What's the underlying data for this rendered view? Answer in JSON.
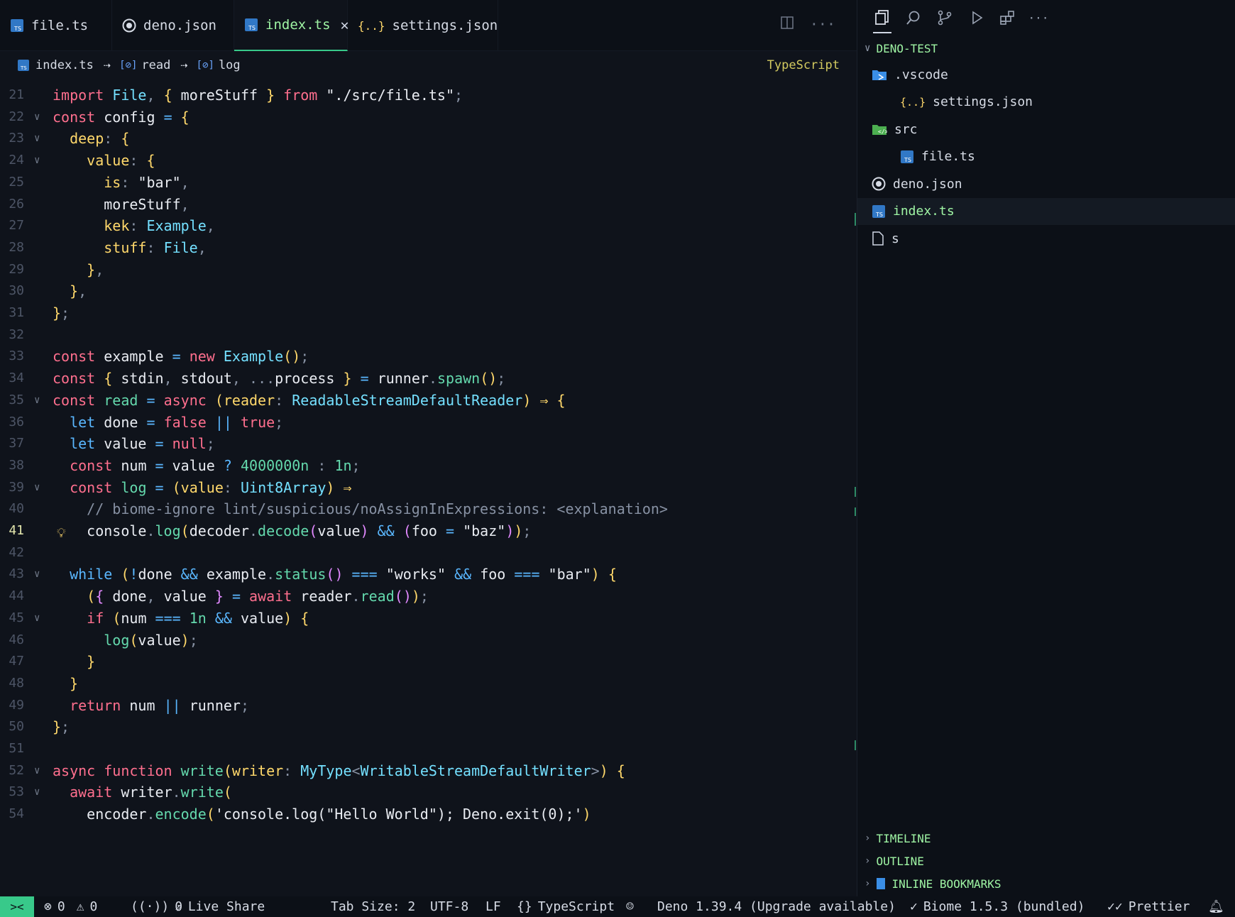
{
  "tabs": [
    {
      "label": "file.ts",
      "icon": "ts-file-icon"
    },
    {
      "label": "deno.json",
      "icon": "deno-icon"
    },
    {
      "label": "index.ts",
      "icon": "ts-file-icon",
      "active": true
    },
    {
      "label": "settings.json",
      "icon": "json-braces-icon"
    }
  ],
  "breadcrumb": {
    "file": "index.ts",
    "sym1": "read",
    "sym2": "log",
    "sep": "⇢",
    "language": "TypeScript"
  },
  "code": {
    "current_line": 41,
    "lines": [
      {
        "n": "21",
        "text": "import File, { moreStuff } from \"./src/file.ts\";"
      },
      {
        "n": "22",
        "text": "const config = {"
      },
      {
        "n": "23",
        "text": "  deep: {"
      },
      {
        "n": "24",
        "text": "    value: {"
      },
      {
        "n": "25",
        "text": "      is: \"bar\","
      },
      {
        "n": "26",
        "text": "      moreStuff,"
      },
      {
        "n": "27",
        "text": "      kek: Example,"
      },
      {
        "n": "28",
        "text": "      stuff: File,"
      },
      {
        "n": "29",
        "text": "    },"
      },
      {
        "n": "30",
        "text": "  },"
      },
      {
        "n": "31",
        "text": "};"
      },
      {
        "n": "32",
        "text": ""
      },
      {
        "n": "33",
        "text": "const example = new Example();"
      },
      {
        "n": "34",
        "text": "const { stdin, stdout, ...process } = runner.spawn();"
      },
      {
        "n": "35",
        "text": "const read = async (reader: ReadableStreamDefaultReader) ⇒ {"
      },
      {
        "n": "36",
        "text": "  let done = false || true;"
      },
      {
        "n": "37",
        "text": "  let value = null;"
      },
      {
        "n": "38",
        "text": "  const num = value ? 4000000n : 1n;"
      },
      {
        "n": "39",
        "text": "  const log = (value: Uint8Array) ⇒"
      },
      {
        "n": "40",
        "text": "    // biome-ignore lint/suspicious/noAssignInExpressions: <explanation>"
      },
      {
        "n": "41",
        "text": "    console.log(decoder.decode(value) && (foo = \"baz\"));"
      },
      {
        "n": "42",
        "text": ""
      },
      {
        "n": "43",
        "text": "  while (!done && example.status() === \"works\" && foo === \"bar\") {"
      },
      {
        "n": "44",
        "text": "    ({ done, value } = await reader.read());"
      },
      {
        "n": "45",
        "text": "    if (num === 1n && value) {"
      },
      {
        "n": "46",
        "text": "      log(value);"
      },
      {
        "n": "47",
        "text": "    }"
      },
      {
        "n": "48",
        "text": "  }"
      },
      {
        "n": "49",
        "text": "  return num || runner;"
      },
      {
        "n": "50",
        "text": "};"
      },
      {
        "n": "51",
        "text": ""
      },
      {
        "n": "52",
        "text": "async function write(writer: MyType<WritableStreamDefaultWriter>) {"
      },
      {
        "n": "53",
        "text": "  await writer.write("
      },
      {
        "n": "54",
        "text": "    encoder.encode('console.log(\"Hello World\"); Deno.exit(0);')"
      }
    ]
  },
  "explorer": {
    "title": "DENO-TEST",
    "items": [
      {
        "label": ".vscode",
        "icon": "vscode-folder-icon",
        "depth": 0
      },
      {
        "label": "settings.json",
        "icon": "json-braces-icon",
        "depth": 1
      },
      {
        "label": "src",
        "icon": "src-folder-icon",
        "depth": 0
      },
      {
        "label": "file.ts",
        "icon": "ts-file-icon",
        "depth": 1
      },
      {
        "label": "deno.json",
        "icon": "deno-icon",
        "depth": 0
      },
      {
        "label": "index.ts",
        "icon": "ts-file-icon",
        "depth": 0,
        "selected": true
      },
      {
        "label": "s",
        "icon": "file-icon",
        "depth": 0
      }
    ],
    "sections": [
      "TIMELINE",
      "OUTLINE",
      "INLINE BOOKMARKS"
    ]
  },
  "status": {
    "errors": "0",
    "warnings": "0",
    "ports": "0",
    "live_share": "Live Share",
    "tab_size": "Tab Size: 2",
    "encoding": "UTF-8",
    "eol": "LF",
    "language": "TypeScript",
    "deno": "Deno 1.39.4 (Upgrade available)",
    "biome": "Biome 1.5.3 (bundled)",
    "prettier": "Prettier"
  },
  "colors": {
    "accent": "#38c98a",
    "active_text": "#9ff5a4"
  }
}
